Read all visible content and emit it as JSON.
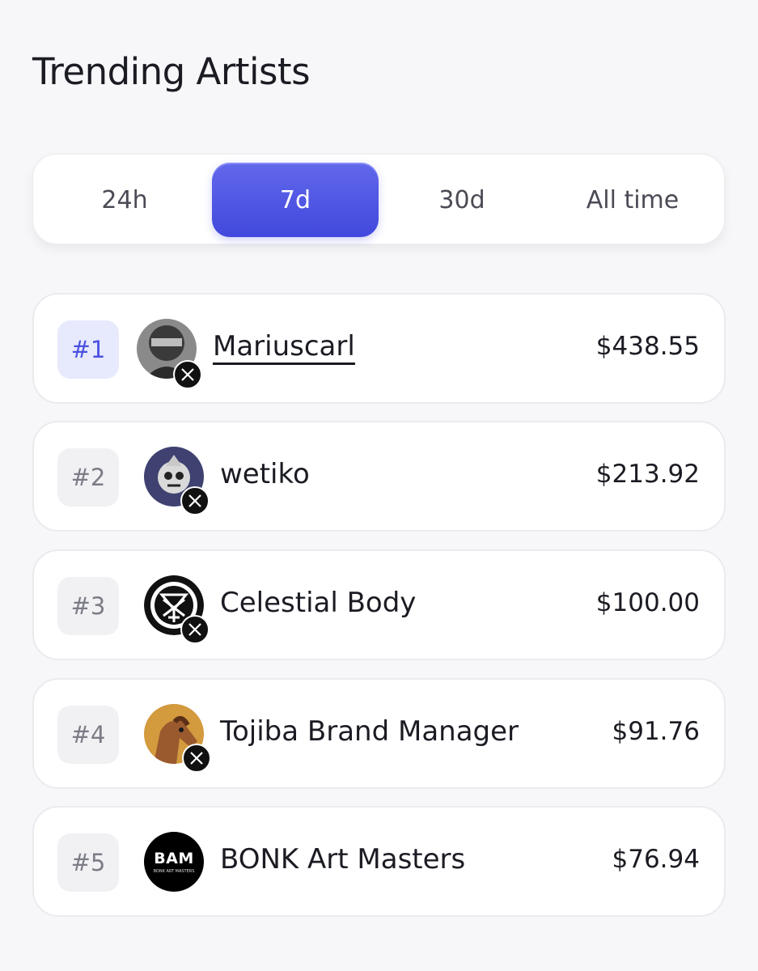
{
  "page": {
    "title": "Trending Artists"
  },
  "tabs": [
    {
      "label": "24h",
      "active": false
    },
    {
      "label": "7d",
      "active": true
    },
    {
      "label": "30d",
      "active": false
    },
    {
      "label": "All time",
      "active": false
    }
  ],
  "accent_color": "#4c52e3",
  "artists": [
    {
      "rank": "#1",
      "name": "Mariuscarl",
      "amount": "$438.55",
      "social_icon": "x-logo-icon"
    },
    {
      "rank": "#2",
      "name": "wetiko",
      "amount": "$213.92",
      "social_icon": "x-logo-icon"
    },
    {
      "rank": "#3",
      "name": "Celestial Body",
      "amount": "$100.00",
      "social_icon": "x-logo-icon"
    },
    {
      "rank": "#4",
      "name": "Tojiba Brand Manager",
      "amount": "$91.76",
      "social_icon": "x-logo-icon"
    },
    {
      "rank": "#5",
      "name": "BONK Art Masters",
      "amount": "$76.94",
      "avatar_text": "BAM",
      "avatar_subtext": "BONK ART MASTERS"
    }
  ]
}
